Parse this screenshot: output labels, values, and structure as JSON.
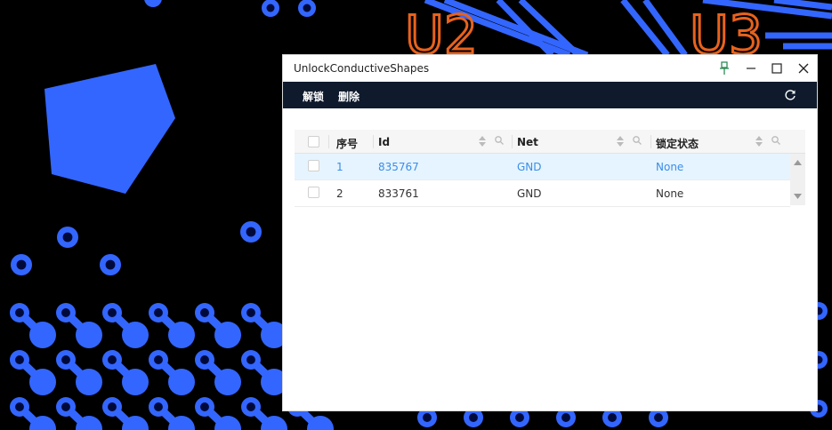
{
  "window": {
    "title": "UnlockConductiveShapes"
  },
  "toolbar": {
    "unlock_label": "解锁",
    "delete_label": "删除"
  },
  "background": {
    "labels": [
      "U2",
      "U3"
    ]
  },
  "colors": {
    "toolbar": "#0f1b2d",
    "accent": "#3a8ee6",
    "pcb_blue": "#3366ff",
    "pcb_orange": "#e8621c",
    "pin_green": "#2e8b57"
  },
  "icons": {
    "pin": "pin-icon",
    "minimize": "minimize-icon",
    "maximize": "maximize-icon",
    "close": "close-icon",
    "refresh": "refresh-icon",
    "sort": "sort-icon",
    "filter": "search-icon"
  },
  "table": {
    "columns": [
      "序号",
      "Id",
      "Net",
      "锁定状态"
    ],
    "rows": [
      {
        "index": "1",
        "id": "835767",
        "net": "GND",
        "lock": "None",
        "selected": true
      },
      {
        "index": "2",
        "id": "833761",
        "net": "GND",
        "lock": "None",
        "selected": false
      }
    ]
  }
}
